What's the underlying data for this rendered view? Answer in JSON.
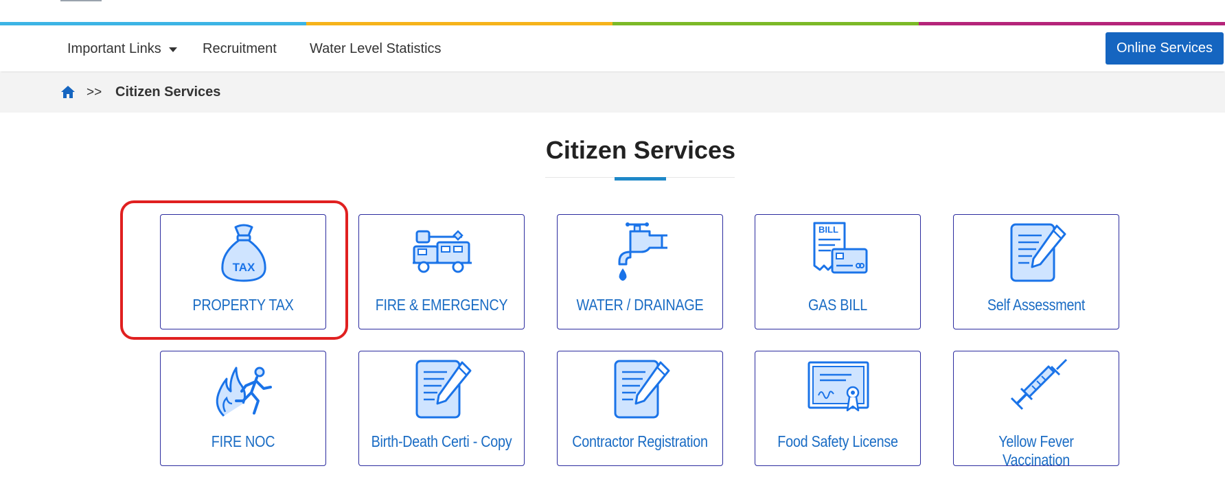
{
  "colors": {
    "strip": [
      "#3cb4e5",
      "#f6b31b",
      "#7cb927",
      "#b5247a"
    ],
    "accent": "#1565c0",
    "icon": "#1a73e8"
  },
  "nav": {
    "items": [
      {
        "label": "Important Links",
        "dropdown": true
      },
      {
        "label": "Recruitment"
      },
      {
        "label": "Water Level Statistics"
      }
    ],
    "online_label": "Online Services"
  },
  "breadcrumb": {
    "separator": ">>",
    "current": "Citizen Services",
    "home_icon": "home-icon"
  },
  "page": {
    "title": "Citizen Services"
  },
  "services": [
    {
      "label": "PROPERTY TAX",
      "icon": "tax-bag-icon",
      "highlighted": true
    },
    {
      "label": "FIRE & EMERGENCY",
      "icon": "fire-truck-icon"
    },
    {
      "label": "WATER / DRAINAGE",
      "icon": "water-tap-icon"
    },
    {
      "label": "GAS BILL",
      "icon": "bill-card-icon"
    },
    {
      "label": "Self Assessment",
      "icon": "document-pen-icon"
    },
    {
      "label": "FIRE NOC",
      "icon": "fire-escape-icon"
    },
    {
      "label": "Birth-Death Certi - Copy",
      "icon": "document-pen-icon"
    },
    {
      "label": "Contractor Registration",
      "icon": "document-pen-icon"
    },
    {
      "label": "Food Safety License",
      "icon": "certificate-icon"
    },
    {
      "label": "Yellow Fever Vaccination",
      "icon": "syringe-icon"
    }
  ]
}
